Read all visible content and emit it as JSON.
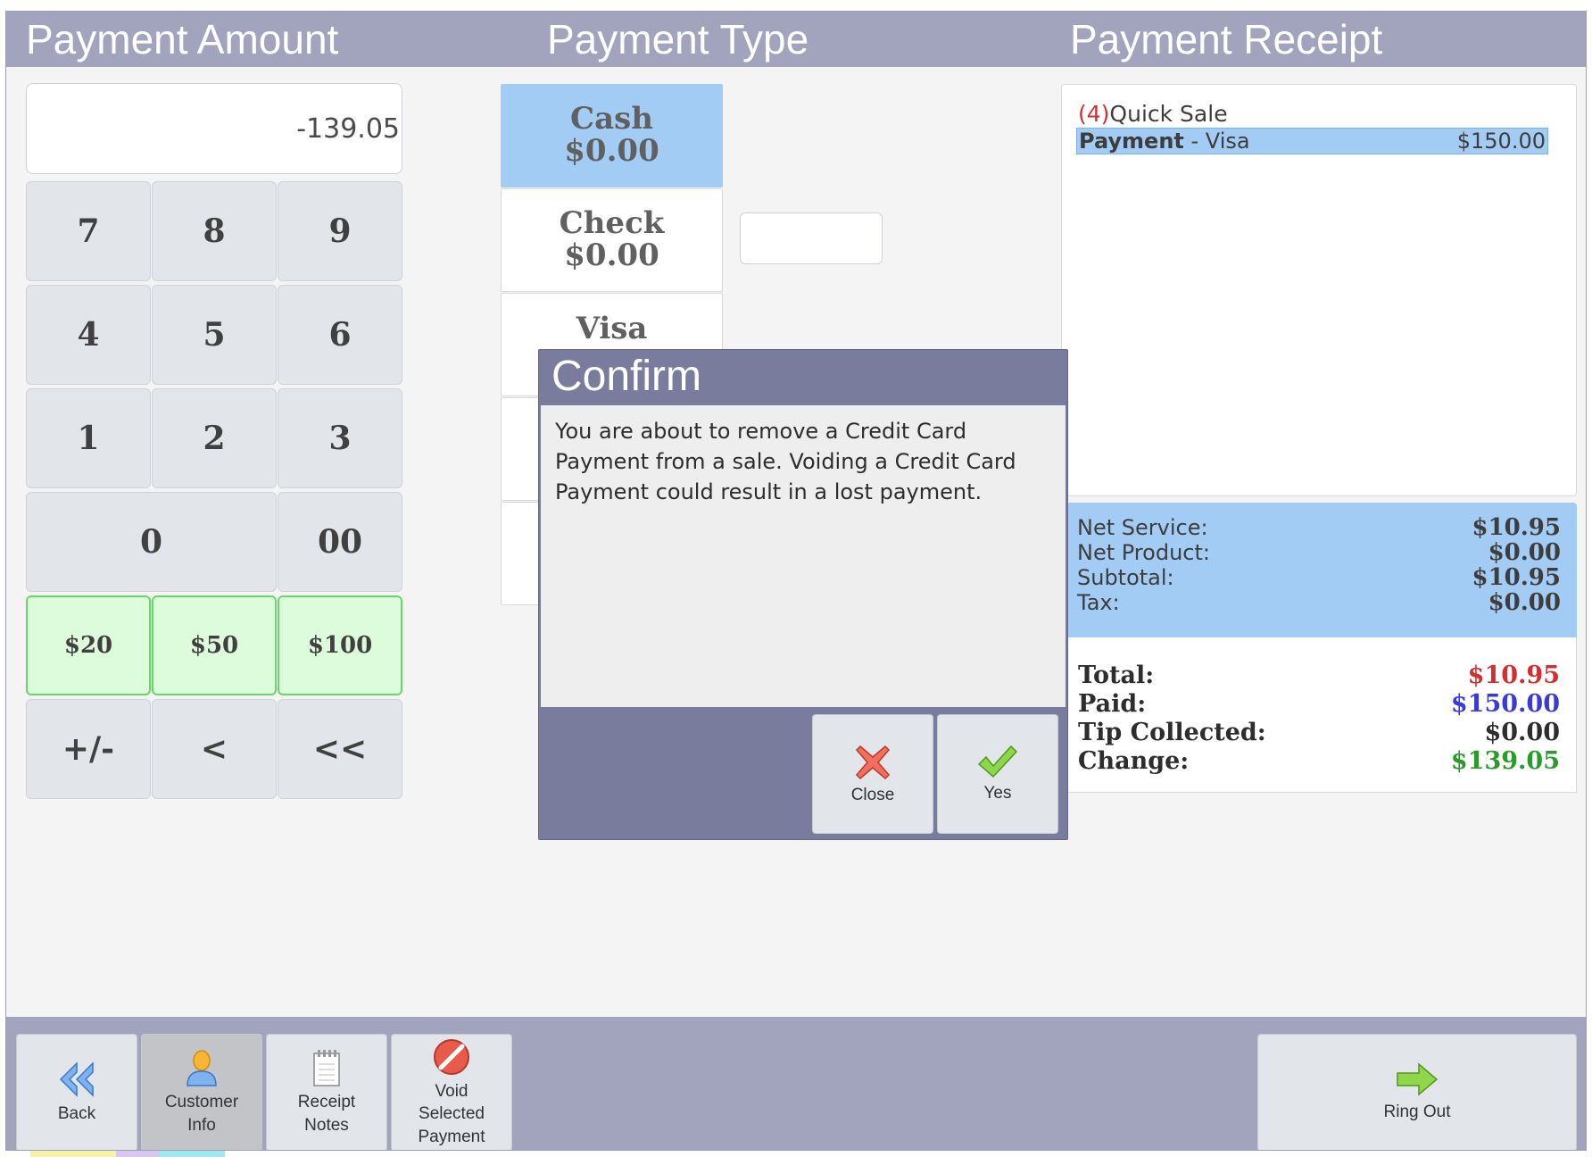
{
  "colors": {
    "header": "#a2a3bd",
    "selected_blue": "#a3ccf5",
    "quick_cash_green": "#dcfcdc",
    "total_red": "#d03030",
    "paid_blue": "#3a3ad8",
    "change_green": "#2a9a2a",
    "dialog": "#7a7c9d"
  },
  "header": {
    "payment_amount_title": "Payment Amount",
    "payment_type_title": "Payment Type",
    "payment_receipt_title": "Payment Receipt"
  },
  "amount": {
    "value": "-139.05"
  },
  "keypad": {
    "keys": [
      "7",
      "8",
      "9",
      "4",
      "5",
      "6",
      "1",
      "2",
      "3",
      "0",
      "00"
    ],
    "quick_cash": [
      "$20",
      "$50",
      "$100"
    ],
    "sign": "+/-",
    "backspace": "<",
    "clear": "<<"
  },
  "payment_types": [
    {
      "name": "Cash",
      "amount": "$0.00",
      "selected": true
    },
    {
      "name": "Check",
      "amount": "$0.00",
      "selected": false
    },
    {
      "name": "Visa",
      "amount": "",
      "selected": false
    }
  ],
  "receipt": {
    "item_count": "(4)",
    "item_title": "Quick Sale",
    "payment_label": "Payment",
    "payment_method": " - Visa",
    "payment_amount": "$150.00"
  },
  "totals": {
    "net_service_label": "Net Service:",
    "net_service": "$10.95",
    "net_product_label": "Net Product:",
    "net_product": "$0.00",
    "subtotal_label": "Subtotal:",
    "subtotal": "$10.95",
    "tax_label": "Tax:",
    "tax": "$0.00",
    "total_label": "Total:",
    "total": "$10.95",
    "paid_label": "Paid:",
    "paid": "$150.00",
    "tip_label": "Tip Collected:",
    "tip": "$0.00",
    "change_label": "Change:",
    "change": "$139.05"
  },
  "dialog": {
    "title": "Confirm",
    "message": "You are about to remove a Credit Card Payment from a sale. Voiding a Credit Card Payment could result in a lost payment.",
    "close_label": "Close",
    "yes_label": "Yes"
  },
  "toolbar": {
    "back": "Back",
    "customer_info_1": "Customer",
    "customer_info_2": "Info",
    "receipt_notes_1": "Receipt",
    "receipt_notes_2": "Notes",
    "void_1": "Void",
    "void_2": "Selected",
    "void_3": "Payment",
    "ring_out": "Ring Out"
  }
}
